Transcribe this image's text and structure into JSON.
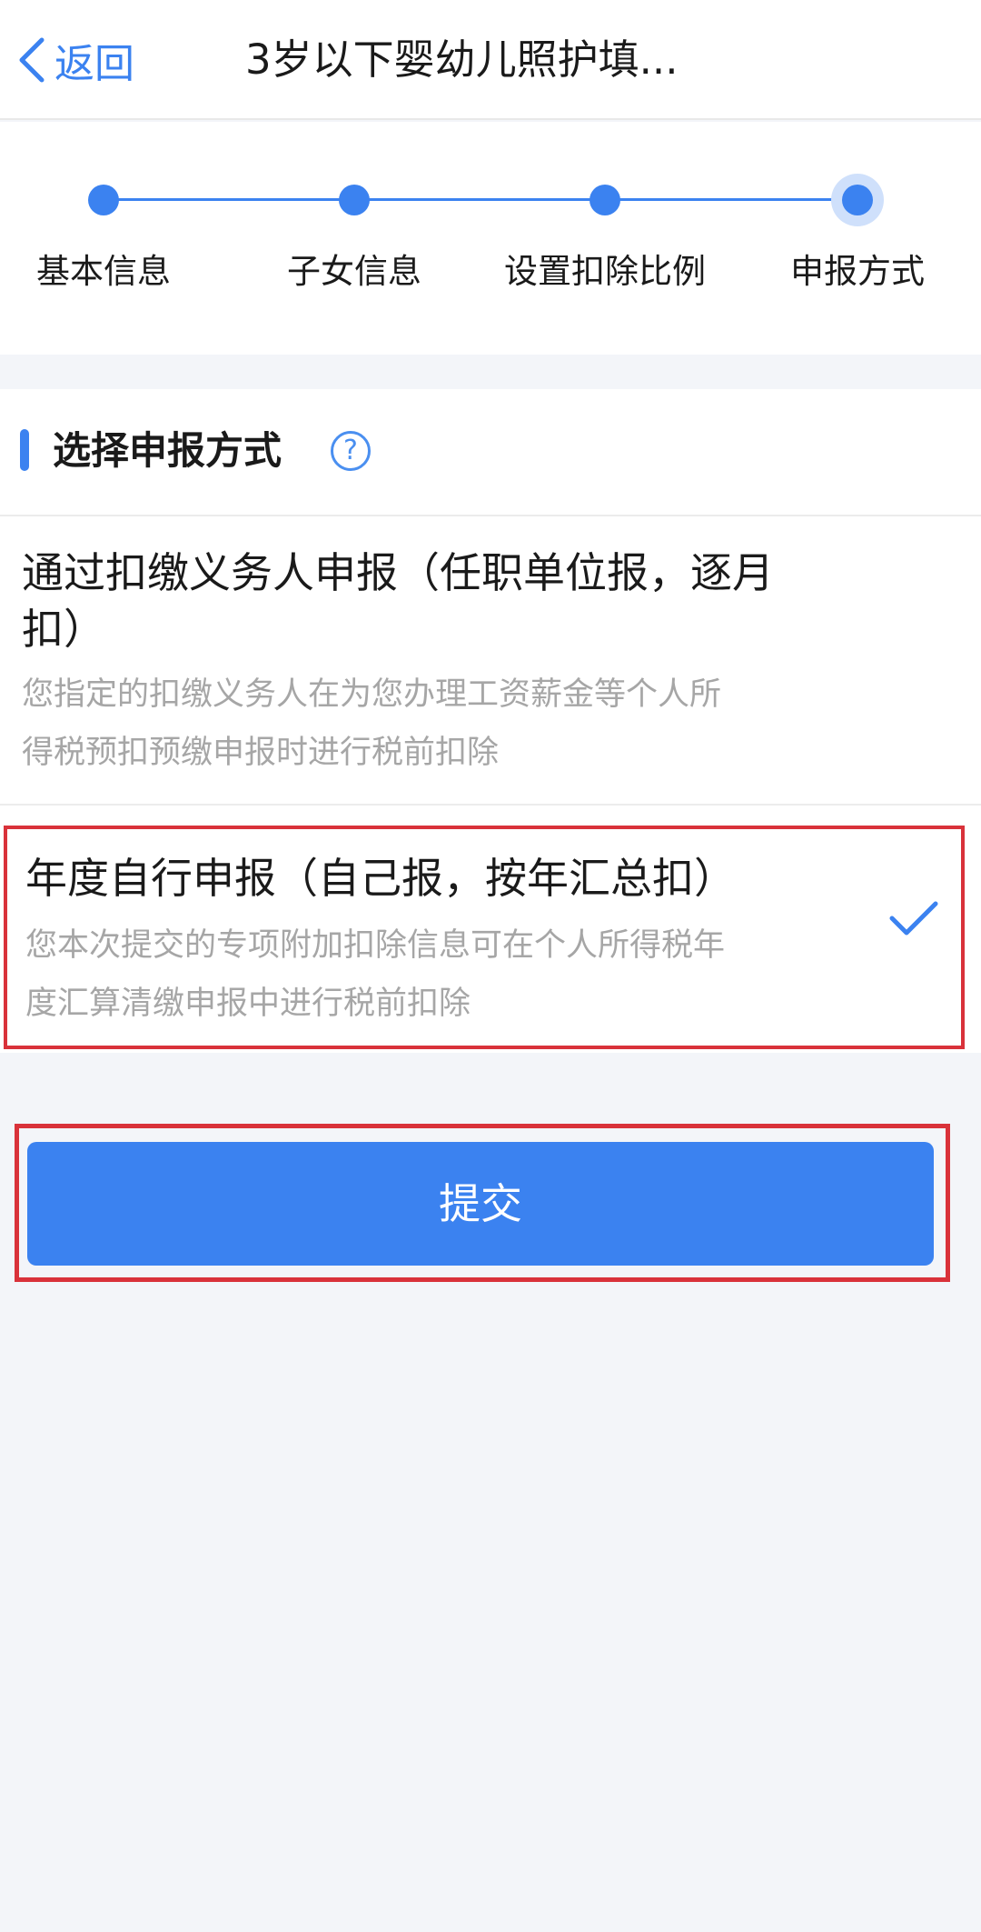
{
  "header": {
    "back_label": "返回",
    "title": "3岁以下婴幼儿照护填..."
  },
  "steps": [
    {
      "label": "基本信息",
      "state": "done"
    },
    {
      "label": "子女信息",
      "state": "done"
    },
    {
      "label": "设置扣除比例",
      "state": "done"
    },
    {
      "label": "申报方式",
      "state": "current"
    }
  ],
  "section": {
    "title": "选择申报方式",
    "help_icon": "question-mark-icon"
  },
  "options": [
    {
      "title_line1": "通过扣缴义务人申报（任职单位报，逐月",
      "title_line2": "扣）",
      "desc_line1": "您指定的扣缴义务人在为您办理工资薪金等个人所",
      "desc_line2": "得税预扣预缴申报时进行税前扣除",
      "selected": false
    },
    {
      "title_line1": "年度自行申报（自己报，按年汇总扣）",
      "desc_line1": "您本次提交的专项附加扣除信息可在个人所得税年",
      "desc_line2": "度汇算清缴申报中进行税前扣除",
      "selected": true
    }
  ],
  "submit_label": "提交",
  "colors": {
    "accent": "#3b82f0",
    "highlight_border": "#d9323a",
    "background": "#f3f5f9",
    "desc_text": "#a6a6a6"
  }
}
